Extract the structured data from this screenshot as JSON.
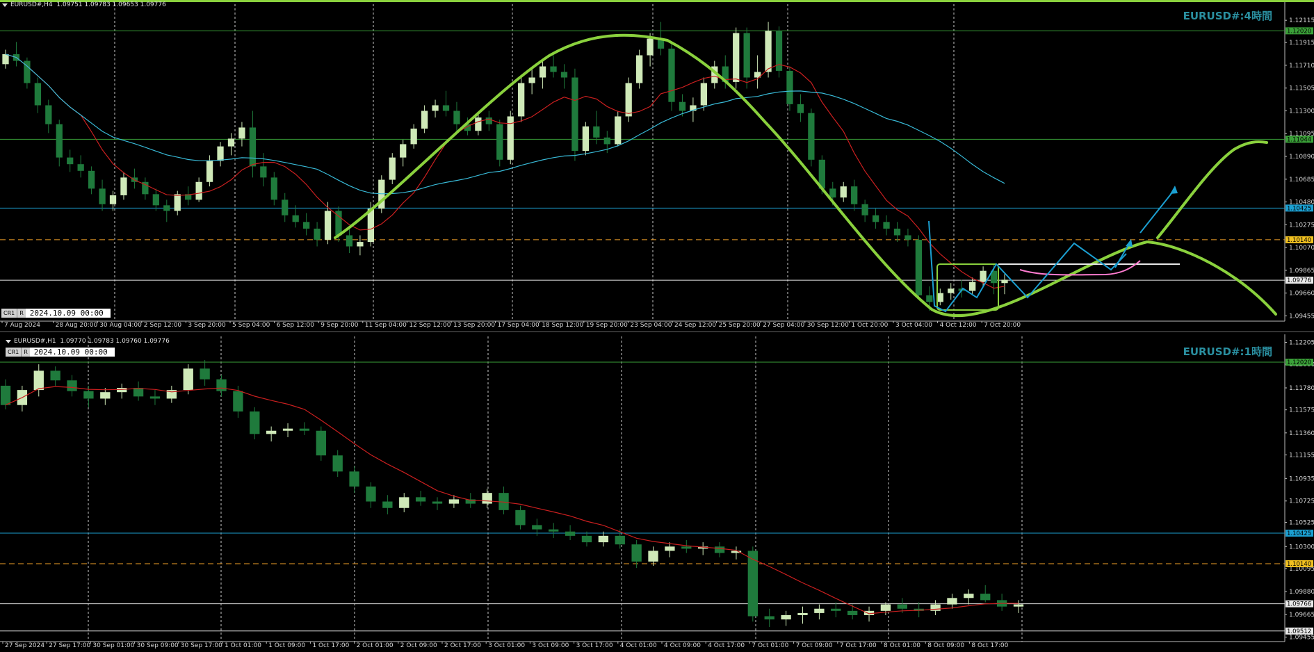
{
  "colors": {
    "background": "#000000",
    "grid": "#c8c8c8",
    "bull": "#cfe9b8",
    "bear": "#1f7a3c",
    "accent_green": "#8ad13d",
    "ma_red": "#c91f1f",
    "ma_cyan": "#38b9d6",
    "magenta": "#ff7bd0",
    "support_blue": "#1b9fd1",
    "level_orange": "#f0a028",
    "level_green": "#3aa038",
    "white_line": "#e8e8e8",
    "watermark": "#2a8fa0"
  },
  "panels": [
    {
      "id": "h4",
      "header": "EURUSD#,H4  1.09751 1.09783 1.09653 1.09776",
      "watermark": "EURUSD#:4時間",
      "cursor_tag": "CR1",
      "cursor_mode": "R",
      "cursor_time": "2024.10.09 00:00",
      "icon": "triangle-down-icon"
    },
    {
      "id": "h1",
      "header": "EURUSD#,H1  1.09770 1.09783 1.09760 1.09776",
      "watermark": "EURUSD#:1時間",
      "cursor_tag": "CR1",
      "cursor_mode": "R",
      "cursor_time": "2024.10.09 00:00",
      "icon": "triangle-down-icon"
    }
  ],
  "chart_data": [
    {
      "type": "candlestick",
      "timeframe": "H4",
      "y_ticks": [
        "1.12115",
        "1.11915",
        "1.11710",
        "1.11505",
        "1.11300",
        "1.11095",
        "1.10890",
        "1.10685",
        "1.10480",
        "1.10275",
        "1.10070",
        "1.09865",
        "1.09660",
        "1.09455"
      ],
      "ylim": [
        1.0942,
        1.1226
      ],
      "x_labels": [
        "7 Aug 2024",
        "28 Aug 20:00",
        "30 Aug 04:00",
        "2 Sep 12:00",
        "3 Sep 20:00",
        "5 Sep 04:00",
        "6 Sep 12:00",
        "9 Sep 20:00",
        "11 Sep 04:00",
        "12 Sep 12:00",
        "13 Sep 20:00",
        "17 Sep 04:00",
        "18 Sep 12:00",
        "19 Sep 20:00",
        "23 Sep 04:00",
        "24 Sep 12:00",
        "25 Sep 20:00",
        "27 Sep 04:00",
        "30 Sep 12:00",
        "1 Oct 20:00",
        "3 Oct 04:00",
        "4 Oct 12:00",
        "7 Oct 20:00"
      ],
      "price_tags": [
        {
          "label": "1.12020",
          "value": 1.1202,
          "bg": "#3aa038",
          "fg": "#000000"
        },
        {
          "label": "1.11044",
          "value": 1.11044,
          "bg": "#3aa038",
          "fg": "#000000"
        },
        {
          "label": "1.10425",
          "value": 1.10425,
          "bg": "#1b9fd1",
          "fg": "#000000"
        },
        {
          "label": "1.10140",
          "value": 1.1014,
          "bg": "#f0c020",
          "fg": "#000000"
        },
        {
          "label": "1.09776",
          "value": 1.09776,
          "bg": "#e8e8e8",
          "fg": "#000000"
        }
      ],
      "candles": [
        [
          1.1172,
          1.1185,
          1.1168,
          1.1181
        ],
        [
          1.1181,
          1.1192,
          1.117,
          1.1175
        ],
        [
          1.1175,
          1.1178,
          1.115,
          1.1155
        ],
        [
          1.1155,
          1.116,
          1.1128,
          1.1135
        ],
        [
          1.1135,
          1.114,
          1.111,
          1.1118
        ],
        [
          1.1118,
          1.1122,
          1.108,
          1.1088
        ],
        [
          1.1088,
          1.1095,
          1.1075,
          1.1082
        ],
        [
          1.1082,
          1.109,
          1.107,
          1.1076
        ],
        [
          1.1076,
          1.108,
          1.1055,
          1.106
        ],
        [
          1.106,
          1.1068,
          1.104,
          1.1046
        ],
        [
          1.1046,
          1.1058,
          1.104,
          1.1054
        ],
        [
          1.1054,
          1.1075,
          1.105,
          1.107
        ],
        [
          1.107,
          1.1078,
          1.106,
          1.1066
        ],
        [
          1.1066,
          1.107,
          1.105,
          1.1055
        ],
        [
          1.1055,
          1.106,
          1.104,
          1.1045
        ],
        [
          1.1045,
          1.105,
          1.103,
          1.104
        ],
        [
          1.104,
          1.1058,
          1.1036,
          1.1055
        ],
        [
          1.1055,
          1.1062,
          1.1045,
          1.105
        ],
        [
          1.105,
          1.107,
          1.1048,
          1.1066
        ],
        [
          1.1066,
          1.109,
          1.1062,
          1.1085
        ],
        [
          1.1085,
          1.1102,
          1.108,
          1.1098
        ],
        [
          1.1098,
          1.111,
          1.109,
          1.1105
        ],
        [
          1.1105,
          1.112,
          1.1098,
          1.1115
        ],
        [
          1.1115,
          1.113,
          1.107,
          1.108
        ],
        [
          1.108,
          1.1092,
          1.1062,
          1.107
        ],
        [
          1.107,
          1.1075,
          1.1045,
          1.105
        ],
        [
          1.105,
          1.1056,
          1.103,
          1.1036
        ],
        [
          1.1036,
          1.1045,
          1.1025,
          1.103
        ],
        [
          1.103,
          1.1038,
          1.1018,
          1.1024
        ],
        [
          1.1024,
          1.103,
          1.1008,
          1.1014
        ],
        [
          1.1014,
          1.1048,
          1.101,
          1.104
        ],
        [
          1.104,
          1.1044,
          1.1012,
          1.1018
        ],
        [
          1.1018,
          1.1024,
          1.1002,
          1.1008
        ],
        [
          1.1008,
          1.1018,
          1.1,
          1.1012
        ],
        [
          1.1012,
          1.1048,
          1.1008,
          1.1042
        ],
        [
          1.1042,
          1.1072,
          1.1038,
          1.1068
        ],
        [
          1.1068,
          1.1092,
          1.1064,
          1.1088
        ],
        [
          1.1088,
          1.1104,
          1.108,
          1.11
        ],
        [
          1.11,
          1.1118,
          1.1096,
          1.1114
        ],
        [
          1.1114,
          1.1135,
          1.111,
          1.113
        ],
        [
          1.113,
          1.114,
          1.1124,
          1.1135
        ],
        [
          1.1135,
          1.1148,
          1.1125,
          1.113
        ],
        [
          1.113,
          1.1138,
          1.1112,
          1.1118
        ],
        [
          1.1118,
          1.1124,
          1.1108,
          1.1112
        ],
        [
          1.1112,
          1.1128,
          1.1108,
          1.1124
        ],
        [
          1.1124,
          1.113,
          1.1112,
          1.1118
        ],
        [
          1.1118,
          1.1122,
          1.108,
          1.1086
        ],
        [
          1.1086,
          1.113,
          1.1082,
          1.1125
        ],
        [
          1.1125,
          1.116,
          1.112,
          1.1155
        ],
        [
          1.1155,
          1.1168,
          1.1145,
          1.116
        ],
        [
          1.116,
          1.1175,
          1.115,
          1.117
        ],
        [
          1.117,
          1.118,
          1.116,
          1.1165
        ],
        [
          1.1165,
          1.1172,
          1.115,
          1.116
        ],
        [
          1.116,
          1.1168,
          1.1085,
          1.1094
        ],
        [
          1.1094,
          1.112,
          1.109,
          1.1116
        ],
        [
          1.1116,
          1.113,
          1.11,
          1.1106
        ],
        [
          1.1106,
          1.1112,
          1.1092,
          1.11
        ],
        [
          1.11,
          1.113,
          1.1098,
          1.1125
        ],
        [
          1.1125,
          1.116,
          1.112,
          1.1155
        ],
        [
          1.1155,
          1.1185,
          1.115,
          1.118
        ],
        [
          1.118,
          1.12,
          1.117,
          1.1195
        ],
        [
          1.1195,
          1.121,
          1.118,
          1.1186
        ],
        [
          1.1186,
          1.119,
          1.113,
          1.1138
        ],
        [
          1.1138,
          1.1145,
          1.1125,
          1.113
        ],
        [
          1.113,
          1.1142,
          1.112,
          1.1135
        ],
        [
          1.1135,
          1.116,
          1.113,
          1.1155
        ],
        [
          1.1155,
          1.1175,
          1.115,
          1.117
        ],
        [
          1.117,
          1.118,
          1.115,
          1.1156
        ],
        [
          1.1156,
          1.1205,
          1.115,
          1.12
        ],
        [
          1.12,
          1.1205,
          1.115,
          1.116
        ],
        [
          1.116,
          1.118,
          1.115,
          1.1165
        ],
        [
          1.1165,
          1.121,
          1.116,
          1.1202
        ],
        [
          1.1202,
          1.1206,
          1.116,
          1.1166
        ],
        [
          1.1166,
          1.117,
          1.113,
          1.1136
        ],
        [
          1.1136,
          1.1145,
          1.112,
          1.1128
        ],
        [
          1.1128,
          1.1132,
          1.108,
          1.1086
        ],
        [
          1.1086,
          1.109,
          1.1055,
          1.106
        ],
        [
          1.106,
          1.1066,
          1.1045,
          1.1052
        ],
        [
          1.1052,
          1.1066,
          1.1048,
          1.1062
        ],
        [
          1.1062,
          1.1068,
          1.104,
          1.1046
        ],
        [
          1.1046,
          1.105,
          1.103,
          1.1036
        ],
        [
          1.1036,
          1.1042,
          1.1024,
          1.103
        ],
        [
          1.103,
          1.1036,
          1.1018,
          1.1024
        ],
        [
          1.1024,
          1.103,
          1.1012,
          1.1018
        ],
        [
          1.1018,
          1.1024,
          1.1008,
          1.1014
        ],
        [
          1.1014,
          1.1018,
          1.096,
          1.0964
        ],
        [
          1.0964,
          1.0972,
          1.095,
          1.0958
        ],
        [
          1.0958,
          1.097,
          1.0955,
          1.0966
        ],
        [
          1.0966,
          1.0975,
          1.096,
          1.097
        ],
        [
          1.097,
          1.0978,
          1.0962,
          1.0968
        ],
        [
          1.0968,
          1.098,
          1.0964,
          1.0976
        ],
        [
          1.0976,
          1.099,
          1.0972,
          1.0986
        ],
        [
          1.0986,
          1.0992,
          1.0965,
          1.0975
        ],
        [
          1.0975,
          1.0983,
          1.0965,
          1.0978
        ]
      ]
    },
    {
      "type": "candlestick",
      "timeframe": "H1",
      "y_ticks": [
        "1.12205",
        "1.12000",
        "1.11780",
        "1.11575",
        "1.11360",
        "1.11155",
        "1.10935",
        "1.10725",
        "1.10525",
        "1.10300",
        "1.10095",
        "1.09880",
        "1.09665",
        "1.09455"
      ],
      "ylim": [
        1.0942,
        1.1226
      ],
      "x_labels": [
        "27 Sep 2024",
        "27 Sep 17:00",
        "30 Sep 01:00",
        "30 Sep 09:00",
        "30 Sep 17:00",
        "1 Oct 01:00",
        "1 Oct 09:00",
        "1 Oct 17:00",
        "2 Oct 01:00",
        "2 Oct 09:00",
        "2 Oct 17:00",
        "3 Oct 01:00",
        "3 Oct 09:00",
        "3 Oct 17:00",
        "4 Oct 01:00",
        "4 Oct 09:00",
        "4 Oct 17:00",
        "7 Oct 01:00",
        "7 Oct 09:00",
        "7 Oct 17:00",
        "8 Oct 01:00",
        "8 Oct 09:00",
        "8 Oct 17:00"
      ],
      "price_tags": [
        {
          "label": "1.12020",
          "value": 1.1202,
          "bg": "#3aa038",
          "fg": "#000000"
        },
        {
          "label": "1.10425",
          "value": 1.10425,
          "bg": "#1b9fd1",
          "fg": "#000000"
        },
        {
          "label": "1.10140",
          "value": 1.1014,
          "bg": "#f0c020",
          "fg": "#000000"
        },
        {
          "label": "1.09766",
          "value": 1.09766,
          "bg": "#e8e8e8",
          "fg": "#000000"
        },
        {
          "label": "1.09512",
          "value": 1.09512,
          "bg": "#e8e8e8",
          "fg": "#000000"
        }
      ],
      "candles": [
        [
          1.118,
          1.1186,
          1.1158,
          1.1162
        ],
        [
          1.1162,
          1.118,
          1.1156,
          1.1176
        ],
        [
          1.1176,
          1.12,
          1.117,
          1.1194
        ],
        [
          1.1194,
          1.1198,
          1.118,
          1.1185
        ],
        [
          1.1185,
          1.119,
          1.117,
          1.1175
        ],
        [
          1.1175,
          1.118,
          1.116,
          1.1168
        ],
        [
          1.1168,
          1.1178,
          1.1162,
          1.1174
        ],
        [
          1.1174,
          1.1182,
          1.1168,
          1.1178
        ],
        [
          1.1178,
          1.1184,
          1.1166,
          1.117
        ],
        [
          1.117,
          1.1176,
          1.1162,
          1.1168
        ],
        [
          1.1168,
          1.118,
          1.1164,
          1.1176
        ],
        [
          1.1176,
          1.12,
          1.1172,
          1.1196
        ],
        [
          1.1196,
          1.1204,
          1.118,
          1.1186
        ],
        [
          1.1186,
          1.119,
          1.117,
          1.1175
        ],
        [
          1.1175,
          1.118,
          1.115,
          1.1156
        ],
        [
          1.1156,
          1.116,
          1.113,
          1.1135
        ],
        [
          1.1135,
          1.1142,
          1.1128,
          1.1138
        ],
        [
          1.1138,
          1.1145,
          1.1132,
          1.114
        ],
        [
          1.114,
          1.1146,
          1.1134,
          1.1138
        ],
        [
          1.1138,
          1.1142,
          1.111,
          1.1115
        ],
        [
          1.1115,
          1.112,
          1.1095,
          1.11
        ],
        [
          1.11,
          1.1105,
          1.108,
          1.1086
        ],
        [
          1.1086,
          1.109,
          1.1066,
          1.1072
        ],
        [
          1.1072,
          1.1078,
          1.106,
          1.1066
        ],
        [
          1.1066,
          1.108,
          1.1062,
          1.1076
        ],
        [
          1.1076,
          1.1082,
          1.1068,
          1.1072
        ],
        [
          1.1072,
          1.1076,
          1.1064,
          1.107
        ],
        [
          1.107,
          1.1078,
          1.1066,
          1.1074
        ],
        [
          1.1074,
          1.108,
          1.1066,
          1.107
        ],
        [
          1.107,
          1.1084,
          1.1066,
          1.108
        ],
        [
          1.108,
          1.1086,
          1.106,
          1.1064
        ],
        [
          1.1064,
          1.1068,
          1.1046,
          1.105
        ],
        [
          1.105,
          1.1056,
          1.104,
          1.1046
        ],
        [
          1.1046,
          1.1052,
          1.1038,
          1.1044
        ],
        [
          1.1044,
          1.105,
          1.1036,
          1.104
        ],
        [
          1.104,
          1.1044,
          1.103,
          1.1034
        ],
        [
          1.1034,
          1.1044,
          1.103,
          1.104
        ],
        [
          1.104,
          1.1046,
          1.1028,
          1.1032
        ],
        [
          1.1032,
          1.1036,
          1.101,
          1.1016
        ],
        [
          1.1016,
          1.103,
          1.1012,
          1.1026
        ],
        [
          1.1026,
          1.1034,
          1.102,
          1.103
        ],
        [
          1.103,
          1.1036,
          1.1024,
          1.1028
        ],
        [
          1.1028,
          1.1034,
          1.1022,
          1.103
        ],
        [
          1.103,
          1.1034,
          1.102,
          1.1024
        ],
        [
          1.1024,
          1.103,
          1.1018,
          1.1026
        ],
        [
          1.1026,
          1.103,
          1.096,
          1.0965
        ],
        [
          1.0965,
          1.0972,
          1.0955,
          1.0962
        ],
        [
          1.0962,
          1.097,
          1.0956,
          1.0966
        ],
        [
          1.0966,
          1.0974,
          1.0958,
          1.0968
        ],
        [
          1.0968,
          1.0976,
          1.0962,
          1.0972
        ],
        [
          1.0972,
          1.0978,
          1.0964,
          1.097
        ],
        [
          1.097,
          1.0976,
          1.0962,
          1.0966
        ],
        [
          1.0966,
          1.0974,
          1.096,
          1.097
        ],
        [
          1.097,
          1.0978,
          1.0966,
          1.0976
        ],
        [
          1.0976,
          1.0982,
          1.0968,
          1.0972
        ],
        [
          1.0972,
          1.0978,
          1.0964,
          1.097
        ],
        [
          1.097,
          1.098,
          1.0966,
          1.0976
        ],
        [
          1.0976,
          1.0986,
          1.0972,
          1.0982
        ],
        [
          1.0982,
          1.099,
          1.0976,
          1.0986
        ],
        [
          1.0986,
          1.0994,
          1.0978,
          1.098
        ],
        [
          1.098,
          1.0986,
          1.097,
          1.0974
        ],
        [
          1.0974,
          1.098,
          1.0968,
          1.0976
        ]
      ]
    }
  ]
}
